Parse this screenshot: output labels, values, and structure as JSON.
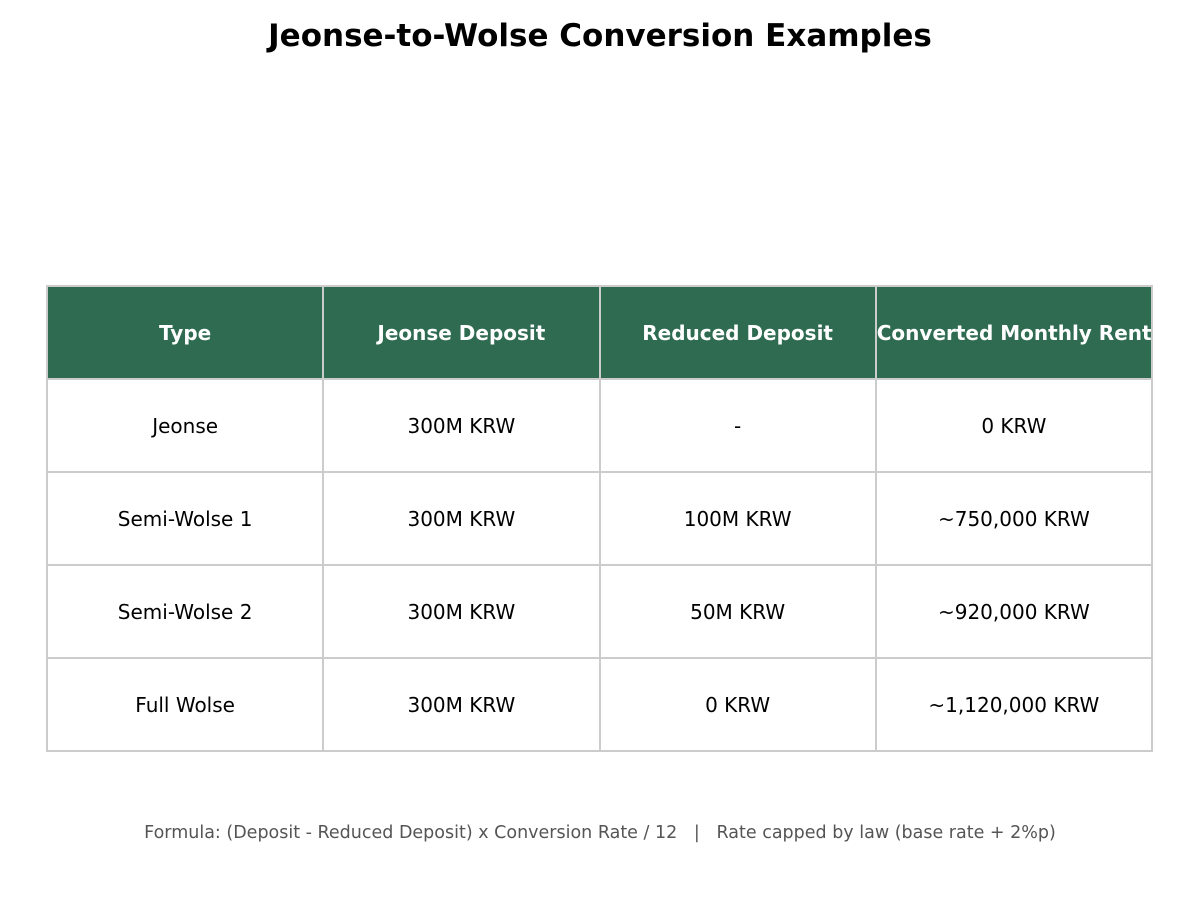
{
  "title": "Jeonse-to-Wolse Conversion Examples",
  "colors": {
    "header_bg": "#2e6b50",
    "header_text": "#ffffff",
    "grid": "#cccccc",
    "footnote": "#555555"
  },
  "chart_data": {
    "type": "table",
    "title": "Jeonse-to-Wolse Conversion Examples",
    "columns": [
      "Type",
      "Jeonse Deposit",
      "Reduced Deposit",
      "Converted Monthly Rent"
    ],
    "rows": [
      [
        "Jeonse",
        "300M KRW",
        "-",
        "0 KRW"
      ],
      [
        "Semi-Wolse 1",
        "300M KRW",
        "100M KRW",
        "~750,000 KRW"
      ],
      [
        "Semi-Wolse 2",
        "300M KRW",
        "50M KRW",
        "~920,000 KRW"
      ],
      [
        "Full Wolse",
        "300M KRW",
        "0 KRW",
        "~1,120,000 KRW"
      ]
    ]
  },
  "footnote": "Formula: (Deposit - Reduced Deposit) x Conversion Rate / 12   |   Rate capped by law (base rate + 2%p)"
}
